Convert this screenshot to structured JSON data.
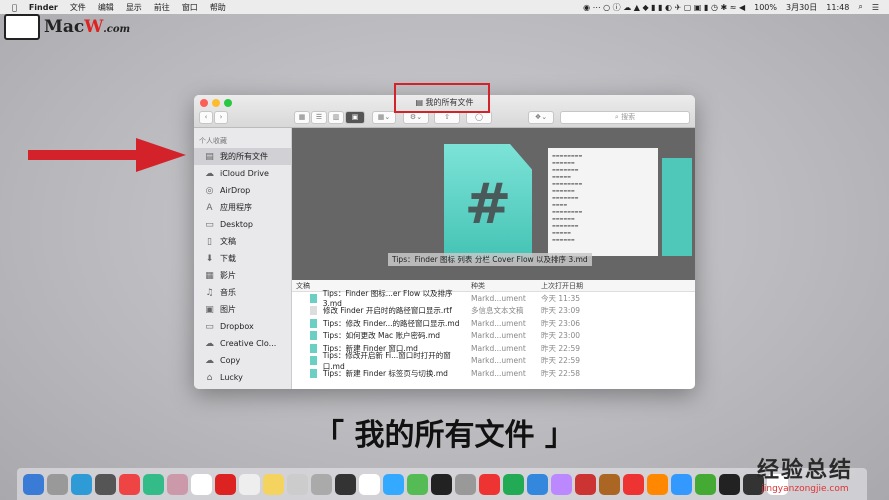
{
  "menubar": {
    "apple": "",
    "items": [
      "Finder",
      "文件",
      "编辑",
      "显示",
      "前往",
      "窗口",
      "帮助"
    ],
    "battery": "100%",
    "date": "3月30日",
    "time": "11:48"
  },
  "logo": {
    "text_a": "Mac",
    "text_b": "W",
    ".com": ".com"
  },
  "window": {
    "title": "我的所有文件",
    "search_placeholder": "搜索",
    "sidebar": {
      "header": "个人收藏",
      "items": [
        {
          "label": "我的所有文件",
          "icon": "all-files-icon",
          "g": "▤"
        },
        {
          "label": "iCloud Drive",
          "icon": "cloud-icon",
          "g": "☁"
        },
        {
          "label": "AirDrop",
          "icon": "airdrop-icon",
          "g": "◎"
        },
        {
          "label": "应用程序",
          "icon": "applications-icon",
          "g": "A"
        },
        {
          "label": "Desktop",
          "icon": "folder-icon",
          "g": "▭"
        },
        {
          "label": "文稿",
          "icon": "documents-icon",
          "g": "▯"
        },
        {
          "label": "下载",
          "icon": "download-icon",
          "g": "⬇"
        },
        {
          "label": "影片",
          "icon": "movies-icon",
          "g": "▦"
        },
        {
          "label": "音乐",
          "icon": "music-icon",
          "g": "♫"
        },
        {
          "label": "图片",
          "icon": "pictures-icon",
          "g": "▣"
        },
        {
          "label": "Dropbox",
          "icon": "folder-icon",
          "g": "▭"
        },
        {
          "label": "Creative Clo...",
          "icon": "creative-cloud-icon",
          "g": "☁"
        },
        {
          "label": "Copy",
          "icon": "copy-icon",
          "g": "☁"
        },
        {
          "label": "Lucky",
          "icon": "home-icon",
          "g": "⌂"
        }
      ]
    },
    "preview_label": "Tips：Finder 图标 列表 分栏 Cover Flow 以及排序 3.md",
    "columns": [
      "文稿",
      "种类",
      "上次打开日期"
    ],
    "rows": [
      {
        "name": "Tips：Finder 图标...er Flow 以及排序 3.md",
        "kind": "Markd...ument",
        "date": "今天 11:35",
        "type": "md"
      },
      {
        "name": "修改 Finder 开启时的路径窗口显示.rtf",
        "kind": "多信息文本文稿",
        "date": "昨天 23:09",
        "type": "rtf"
      },
      {
        "name": "Tips：修改 Finder...的路径窗口显示.md",
        "kind": "Markd...ument",
        "date": "昨天 23:06",
        "type": "md"
      },
      {
        "name": "Tips：如何更改 Mac 账户密码.md",
        "kind": "Markd...ument",
        "date": "昨天 23:00",
        "type": "md"
      },
      {
        "name": "Tips：新建 Finder 窗口.md",
        "kind": "Markd...ument",
        "date": "昨天 22:59",
        "type": "md"
      },
      {
        "name": "Tips：修改开启新 Fi...窗口时打开的窗口.md",
        "kind": "Markd...ument",
        "date": "昨天 22:59",
        "type": "md"
      },
      {
        "name": "Tips：新建 Finder 标签页与切换.md",
        "kind": "Markd...ument",
        "date": "昨天 22:58",
        "type": "md"
      }
    ]
  },
  "caption": "「 我的所有文件 」",
  "watermark": {
    "main": "经验总结",
    "url": "jingyanzongjie.com"
  },
  "colors": {
    "accent_red": "#d3222a",
    "selection": "#d0d0d5"
  },
  "dock_colors": [
    "#3a7bd5",
    "#999",
    "#2e9bd6",
    "#555",
    "#e44",
    "#3b8",
    "#c9a",
    "#fff",
    "#d22",
    "#eee",
    "#f4d35e",
    "#ccc",
    "#aaa",
    "#333",
    "#fff",
    "#3af",
    "#5b5",
    "#222",
    "#999",
    "#e33",
    "#2a5",
    "#38d",
    "#b8f",
    "#c33",
    "#a62",
    "#e33",
    "#f80",
    "#39f",
    "#4a3",
    "#222",
    "#333",
    "#fff"
  ]
}
